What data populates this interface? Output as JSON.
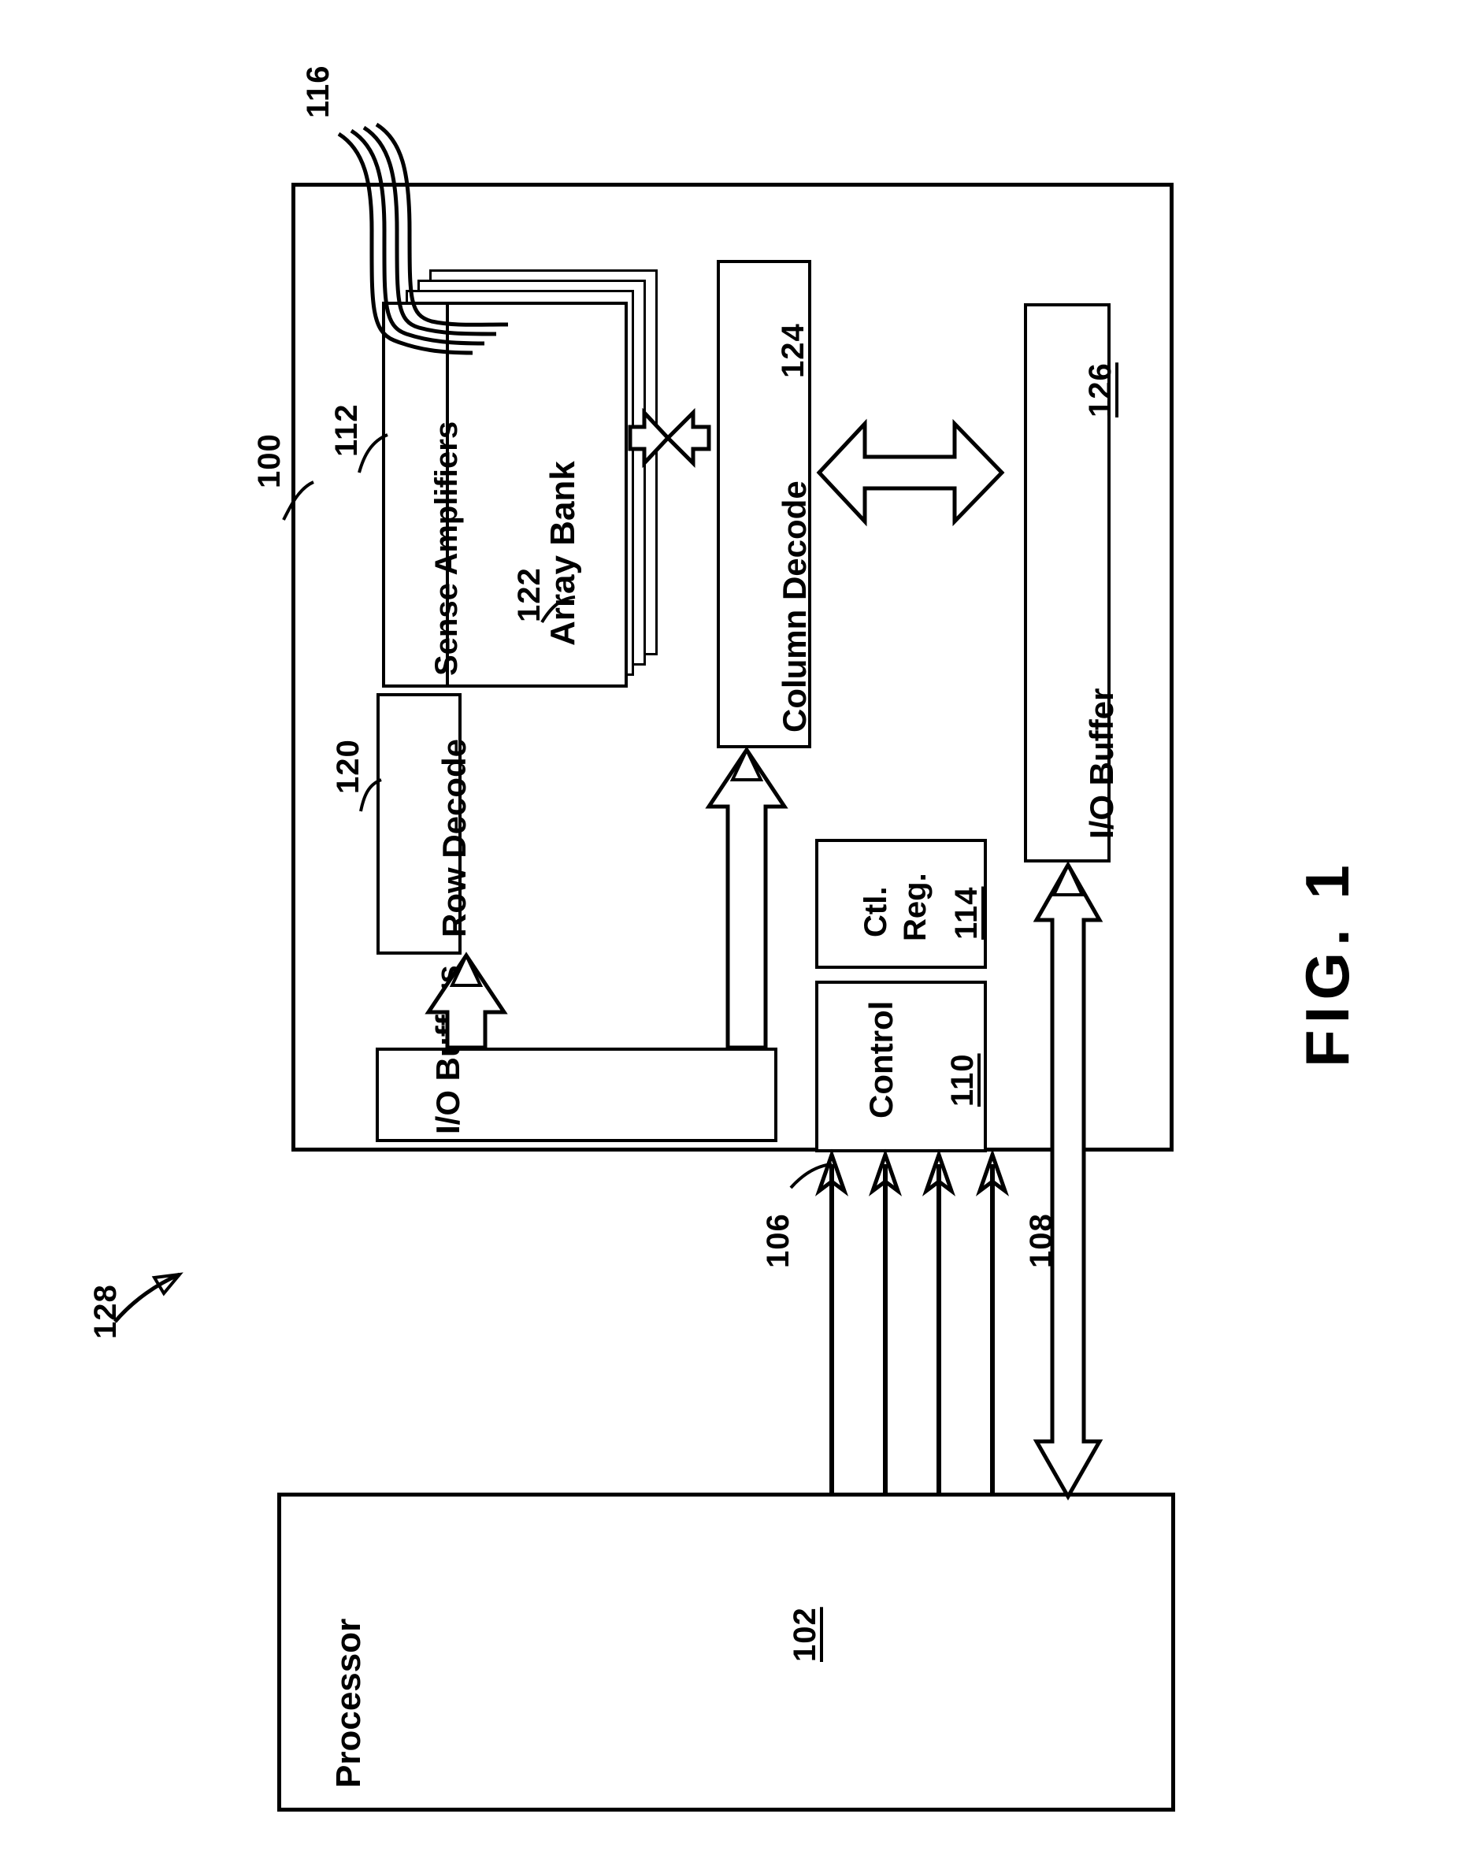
{
  "figure": {
    "caption": "FIG. 1",
    "system_ref": "128"
  },
  "memory_device": {
    "ref": "100",
    "array_bank": {
      "label": "Array Bank",
      "ref": "112",
      "stack_count": 4
    },
    "sense_amplifiers": {
      "label": "Sense Amplifiers",
      "ref": "122"
    },
    "row_decode": {
      "label": "Row Decode",
      "ref": "120"
    },
    "column_decode": {
      "label": "Column Decode",
      "ref": "124"
    },
    "control": {
      "label": "Control",
      "ref": "110"
    },
    "control_register": {
      "label_line1": "Ctl.",
      "label_line2": "Reg.",
      "ref": "114"
    },
    "io_buffers_internal": {
      "label": "I/O Buffers"
    },
    "io_buffer_data": {
      "label": "I/O Buffer",
      "ref": "126"
    },
    "external_lines": {
      "ref": "116"
    }
  },
  "processor": {
    "label": "Processor",
    "ref": "102"
  },
  "buses": {
    "control_address_bus": {
      "ref": "106",
      "line_count": 4
    },
    "data_bus": {
      "ref": "108"
    }
  }
}
